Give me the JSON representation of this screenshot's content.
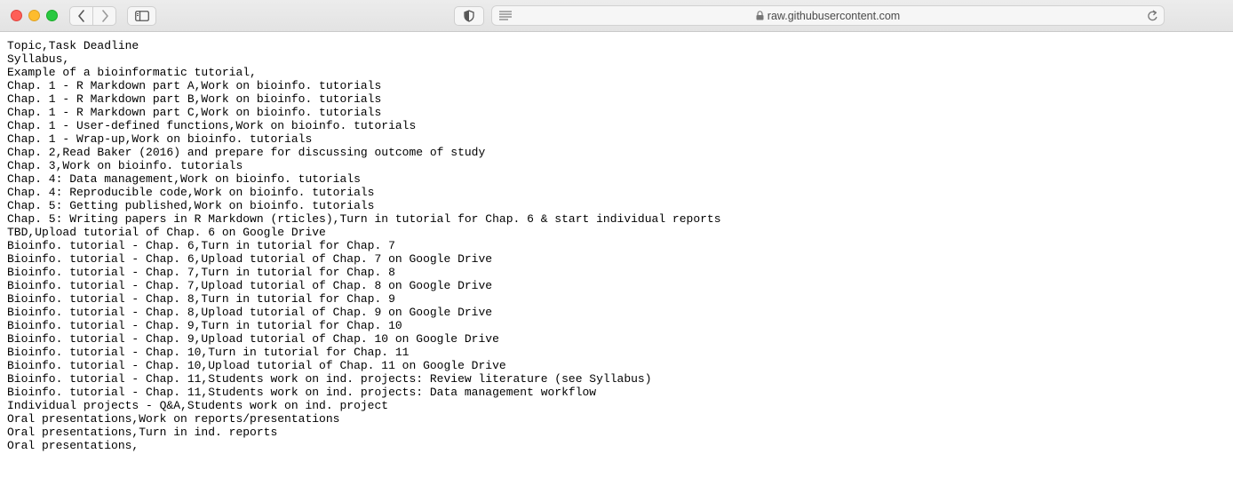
{
  "browser": {
    "url": "raw.githubusercontent.com"
  },
  "document": {
    "lines": [
      "Topic,Task Deadline",
      "Syllabus,",
      "Example of a bioinformatic tutorial,",
      "Chap. 1 - R Markdown part A,Work on bioinfo. tutorials",
      "Chap. 1 - R Markdown part B,Work on bioinfo. tutorials",
      "Chap. 1 - R Markdown part C,Work on bioinfo. tutorials",
      "Chap. 1 - User-defined functions,Work on bioinfo. tutorials",
      "Chap. 1 - Wrap-up,Work on bioinfo. tutorials",
      "Chap. 2,Read Baker (2016) and prepare for discussing outcome of study",
      "Chap. 3,Work on bioinfo. tutorials",
      "Chap. 4: Data management,Work on bioinfo. tutorials",
      "Chap. 4: Reproducible code,Work on bioinfo. tutorials",
      "Chap. 5: Getting published,Work on bioinfo. tutorials",
      "Chap. 5: Writing papers in R Markdown (rticles),Turn in tutorial for Chap. 6 & start individual reports",
      "TBD,Upload tutorial of Chap. 6 on Google Drive",
      "Bioinfo. tutorial - Chap. 6,Turn in tutorial for Chap. 7",
      "Bioinfo. tutorial - Chap. 6,Upload tutorial of Chap. 7 on Google Drive",
      "Bioinfo. tutorial - Chap. 7,Turn in tutorial for Chap. 8",
      "Bioinfo. tutorial - Chap. 7,Upload tutorial of Chap. 8 on Google Drive",
      "Bioinfo. tutorial - Chap. 8,Turn in tutorial for Chap. 9",
      "Bioinfo. tutorial - Chap. 8,Upload tutorial of Chap. 9 on Google Drive",
      "Bioinfo. tutorial - Chap. 9,Turn in tutorial for Chap. 10",
      "Bioinfo. tutorial - Chap. 9,Upload tutorial of Chap. 10 on Google Drive",
      "Bioinfo. tutorial - Chap. 10,Turn in tutorial for Chap. 11",
      "Bioinfo. tutorial - Chap. 10,Upload tutorial of Chap. 11 on Google Drive",
      "Bioinfo. tutorial - Chap. 11,Students work on ind. projects: Review literature (see Syllabus)",
      "Bioinfo. tutorial - Chap. 11,Students work on ind. projects: Data management workflow",
      "Individual projects - Q&A,Students work on ind. project",
      "Oral presentations,Work on reports/presentations",
      "Oral presentations,Turn in ind. reports",
      "Oral presentations,"
    ]
  }
}
